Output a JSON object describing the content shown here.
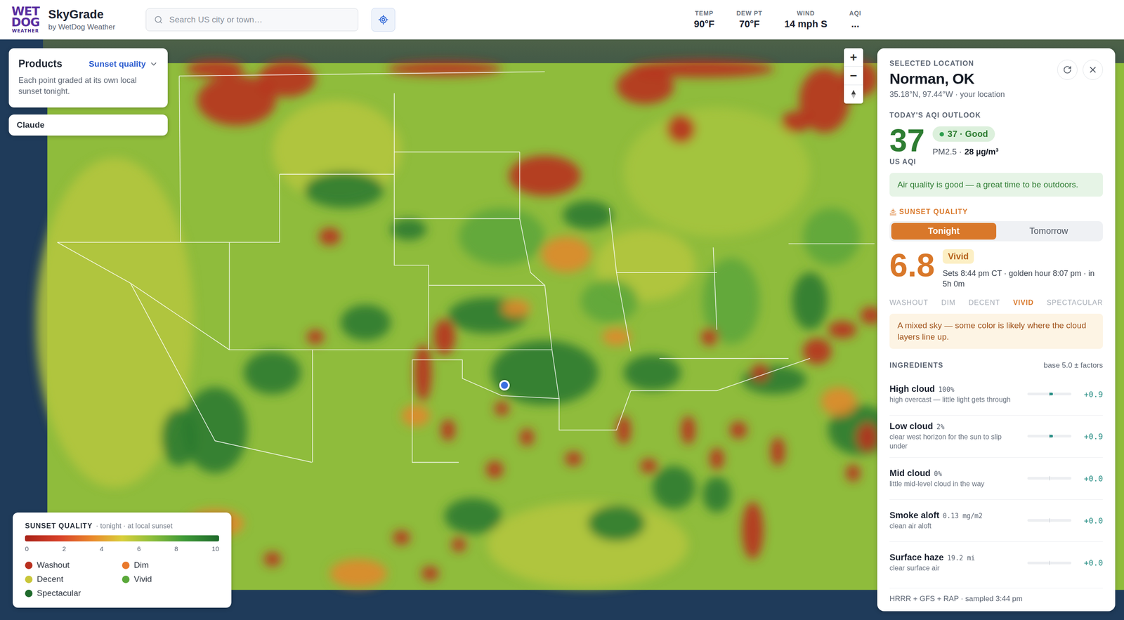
{
  "app": {
    "logo": {
      "top": "WET",
      "middle": "DOG",
      "bottom": "WEATHER"
    },
    "title": "SkyGrade",
    "subtitle": "by WetDog Weather"
  },
  "search": {
    "placeholder": "Search US city or town…"
  },
  "conditions": [
    {
      "label": "TEMP",
      "value": "90°F"
    },
    {
      "label": "DEW PT",
      "value": "70°F"
    },
    {
      "label": "WIND",
      "value": "14 mph S"
    },
    {
      "label": "AQI",
      "value": "..."
    }
  ],
  "products_panel": {
    "title": "Products",
    "selector": "Sunset quality",
    "description": "Each point graded at its own local sunset tonight."
  },
  "user_chip": {
    "label": "Claude"
  },
  "zoom": {
    "in": "+",
    "out": "−"
  },
  "legend": {
    "title": "SUNSET QUALITY",
    "subtitle": "· tonight · at local sunset",
    "ticks": [
      "0",
      "2",
      "4",
      "6",
      "8",
      "10"
    ],
    "items": [
      {
        "label": "Washout",
        "color": "#b9301f"
      },
      {
        "label": "Dim",
        "color": "#e9792c"
      },
      {
        "label": "Decent",
        "color": "#c9c63a"
      },
      {
        "label": "Vivid",
        "color": "#5aa83a"
      },
      {
        "label": "Spectacular",
        "color": "#1f6a2c"
      }
    ]
  },
  "location_panel": {
    "eyebrow": "SELECTED LOCATION",
    "name": "Norman, OK",
    "coords": "35.18°N, 97.44°W · your location",
    "aqi": {
      "heading": "TODAY'S AQI OUTLOOK",
      "value": "37",
      "unit": "US AQI",
      "badge": "37 · Good",
      "pm_label": "PM2.5 ·",
      "pm_value": "28 µg/m³",
      "message": "Air quality is good — a great time to be outdoors."
    },
    "sunset": {
      "heading": "SUNSET QUALITY",
      "tabs": [
        {
          "label": "Tonight",
          "selected": true
        },
        {
          "label": "Tomorrow",
          "selected": false
        }
      ],
      "score": "6.8",
      "badge": "Vivid",
      "details": "Sets 8:44 pm CT · golden hour 8:07 pm · in 5h 0m",
      "scale": [
        {
          "label": "WASHOUT",
          "selected": false
        },
        {
          "label": "DIM",
          "selected": false
        },
        {
          "label": "DECENT",
          "selected": false
        },
        {
          "label": "VIVID",
          "selected": true
        },
        {
          "label": "SPECTACULAR",
          "selected": false
        }
      ],
      "summary": "A mixed sky — some color is likely where the cloud layers line up.",
      "ingredients_heading": "INGREDIENTS",
      "ingredients_note": "base 5.0 ± factors",
      "ingredients": [
        {
          "name": "High cloud",
          "value": "100%",
          "description": "high overcast — little light gets through",
          "level": 0.58,
          "delta": "+0.9"
        },
        {
          "name": "Low cloud",
          "value": "2%",
          "description": "clear west horizon for the sun to slip under",
          "level": 0.58,
          "delta": "+0.9"
        },
        {
          "name": "Mid cloud",
          "value": "0%",
          "description": "little mid-level cloud in the way",
          "level": 0.5,
          "delta": "+0.0"
        },
        {
          "name": "Smoke aloft",
          "value": "0.13 mg/m2",
          "description": "clean air aloft",
          "level": 0.5,
          "delta": "+0.0"
        },
        {
          "name": "Surface haze",
          "value": "19.2 mi",
          "description": "clear surface air",
          "level": 0.5,
          "delta": "+0.0"
        }
      ]
    },
    "footer": "HRRR + GFS + RAP · sampled 3:44 pm"
  }
}
